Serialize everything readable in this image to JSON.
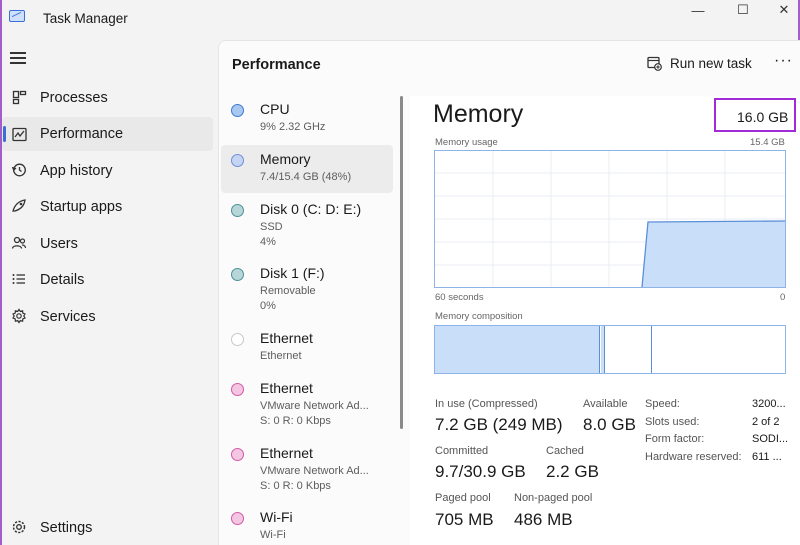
{
  "window": {
    "title": "Task Manager",
    "controls": {
      "minimize": "—",
      "maximize": "☐",
      "close": "✕"
    }
  },
  "sidebar": {
    "items": [
      {
        "label": "Processes",
        "icon": "processes-icon"
      },
      {
        "label": "Performance",
        "icon": "performance-icon",
        "active": true
      },
      {
        "label": "App history",
        "icon": "app-history-icon"
      },
      {
        "label": "Startup apps",
        "icon": "startup-apps-icon"
      },
      {
        "label": "Users",
        "icon": "users-icon"
      },
      {
        "label": "Details",
        "icon": "details-icon"
      },
      {
        "label": "Services",
        "icon": "services-icon"
      }
    ],
    "settings": {
      "label": "Settings",
      "icon": "gear-icon"
    }
  },
  "header": {
    "title": "Performance",
    "run_new_task": "Run new task",
    "more": "···"
  },
  "resources": [
    {
      "name": "CPU",
      "sub1": "9%  2.32 GHz",
      "sub2": "",
      "dot_color": "#3a7bd5",
      "dot_fill": "#a9c8f0"
    },
    {
      "name": "Memory",
      "sub1": "7.4/15.4 GB (48%)",
      "sub2": "",
      "dot_color": "#6f8fd8",
      "dot_fill": "#c5d4f3",
      "active": true
    },
    {
      "name": "Disk 0 (C: D: E:)",
      "sub1": "SSD",
      "sub2": "4%",
      "dot_color": "#4f8f96",
      "dot_fill": "#b7d6d9"
    },
    {
      "name": "Disk 1 (F:)",
      "sub1": "Removable",
      "sub2": "0%",
      "dot_color": "#4f8f96",
      "dot_fill": "#b7d6d9"
    },
    {
      "name": "Ethernet",
      "sub1": "Ethernet",
      "sub2": "",
      "dot_color": "#c8c8c8",
      "dot_fill": "#ffffff"
    },
    {
      "name": "Ethernet",
      "sub1": "VMware Network Ad...",
      "sub2": "S: 0  R: 0 Kbps",
      "dot_color": "#d35aa6",
      "dot_fill": "#f4c6e3"
    },
    {
      "name": "Ethernet",
      "sub1": "VMware Network Ad...",
      "sub2": "S: 0  R: 0 Kbps",
      "dot_color": "#d35aa6",
      "dot_fill": "#f4c6e3"
    },
    {
      "name": "Wi-Fi",
      "sub1": "Wi-Fi",
      "sub2": "",
      "dot_color": "#d35aa6",
      "dot_fill": "#f4c6e3"
    }
  ],
  "memory": {
    "title": "Memory",
    "total": "16.0 GB",
    "usage_label": "Memory usage",
    "usage_max": "15.4 GB",
    "time_label": "60 seconds",
    "time_min": "0",
    "composition_label": "Memory composition",
    "colors": {
      "fill": "#c9dff9",
      "line": "#5b8fd9",
      "grid": "#e8eef6"
    },
    "stats": {
      "in_use_label": "In use (Compressed)",
      "in_use_value": "7.2 GB (249 MB)",
      "available_label": "Available",
      "available_value": "8.0 GB",
      "committed_label": "Committed",
      "committed_value": "9.7/30.9 GB",
      "cached_label": "Cached",
      "cached_value": "2.2 GB",
      "paged_label": "Paged pool",
      "paged_value": "705 MB",
      "nonpaged_label": "Non-paged pool",
      "nonpaged_value": "486 MB"
    },
    "specs": [
      {
        "label": "Speed:",
        "value": "3200..."
      },
      {
        "label": "Slots used:",
        "value": "2 of 2"
      },
      {
        "label": "Form factor:",
        "value": "SODI..."
      },
      {
        "label": "Hardware reserved:",
        "value": "611 ..."
      }
    ]
  }
}
